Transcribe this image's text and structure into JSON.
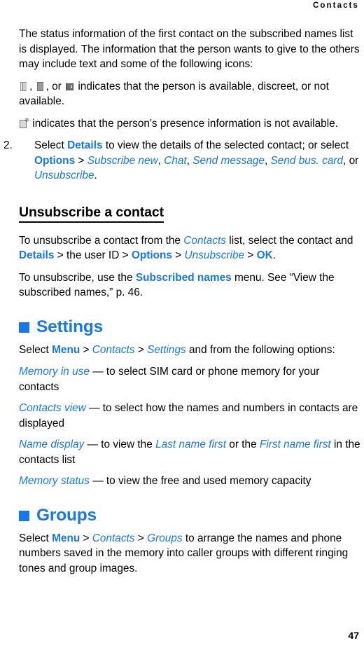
{
  "header": {
    "running_title": "Contacts"
  },
  "colors": {
    "link_blue": "#1878e8",
    "text_black": "#000000",
    "page_background": "#ffffff"
  },
  "body": {
    "intro_paragraph": "The status information of the first contact on the subscribed names list is displayed. The information that the person wants to give to the others may include text and some of the following icons:",
    "icon_line_1": {
      "separator_1": ",",
      "separator_2": ", or",
      "text": "indicates that the person is available, discreet, or not available.",
      "icons": [
        {
          "name": "status-available-icon",
          "meaning": "available"
        },
        {
          "name": "status-discreet-icon",
          "meaning": "discreet"
        },
        {
          "name": "status-not-available-icon",
          "meaning": "not available"
        }
      ]
    },
    "icon_line_2": {
      "icon": {
        "name": "presence-unknown-icon",
        "meaning": "presence information not available"
      },
      "text": "indicates that the person's presence information is not available."
    },
    "step_2": {
      "number": "2.",
      "part_1": "Select ",
      "details": "Details",
      "part_2": " to view the details of the selected contact; or select ",
      "options": "Options",
      "gt_1": " > ",
      "subscribe_new": "Subscribe new",
      "comma_1": ", ",
      "chat": "Chat",
      "comma_2": ", ",
      "send_message": "Send message",
      "comma_3": ", ",
      "send_bus_card": "Send bus. card",
      "or": ", or ",
      "unsubscribe": "Unsubscribe",
      "period": "."
    }
  },
  "unsubscribe_section": {
    "heading": "Unsubscribe a contact",
    "paragraph_1": {
      "part_1": "To unsubscribe a contact from the ",
      "contacts": "Contacts",
      "part_2": " list, select the contact and ",
      "details": "Details",
      "gt_1": " > ",
      "part_3": "the user ID",
      "gt_2": " > ",
      "options": "Options",
      "gt_3": " > ",
      "unsubscribe": "Unsubscribe",
      "gt_4": " > ",
      "ok": "OK",
      "period": "."
    },
    "paragraph_2": {
      "part_1": "To unsubscribe, use the ",
      "subscribed_names": "Subscribed names",
      "part_2": " menu. See “View the subscribed names,” p. 46."
    }
  },
  "settings_section": {
    "heading": "Settings",
    "intro": {
      "part_1": "Select ",
      "menu": "Menu",
      "gt_1": " > ",
      "contacts": "Contacts",
      "gt_2": " > ",
      "settings": "Settings",
      "part_2": " and from the following options:"
    },
    "options": [
      {
        "name": "Memory in use",
        "dash": " — ",
        "description": "to select SIM card or phone memory for your contacts"
      },
      {
        "name": "Contacts view",
        "dash": " — ",
        "description": "to select how the names and numbers in contacts are displayed"
      },
      {
        "name": "Name display",
        "dash": " — ",
        "description_part_1": "to view the ",
        "value_1": "Last name first",
        "description_part_2": " or the ",
        "value_2": "First name first",
        "description_part_3": " in the contacts list"
      },
      {
        "name": "Memory status",
        "dash": " — ",
        "description": "to view the free and used memory capacity"
      }
    ]
  },
  "groups_section": {
    "heading": "Groups",
    "paragraph": {
      "part_1": "Select ",
      "menu": "Menu",
      "gt_1": " > ",
      "contacts": "Contacts",
      "gt_2": " > ",
      "groups": "Groups",
      "part_2": " to arrange the names and phone numbers saved in the memory into caller groups with different ringing tones and group images."
    }
  },
  "footer": {
    "page_number": "47"
  }
}
